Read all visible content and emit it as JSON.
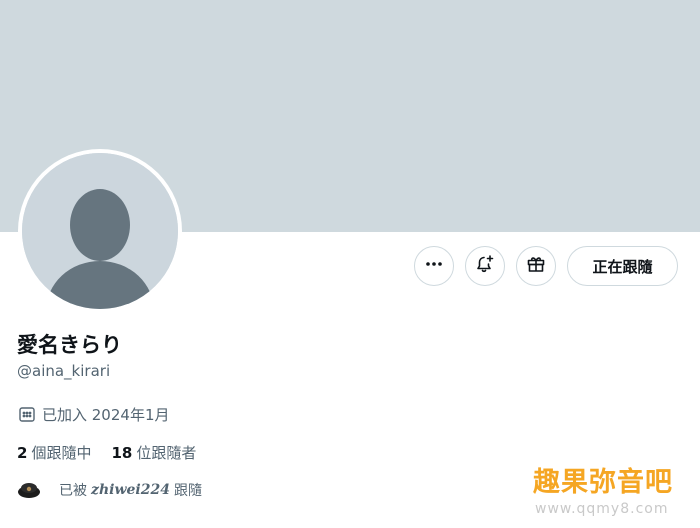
{
  "profile": {
    "display_name": "愛名きらり",
    "handle": "@aina_kirari",
    "joined": "已加入 2024年1月"
  },
  "actions": {
    "more_icon": "more-horizontal-icon",
    "notify_icon": "bell-plus-icon",
    "gift_icon": "gift-icon",
    "following_label": "正在跟隨"
  },
  "stats": {
    "following_count": "2",
    "following_label": "個跟隨中",
    "followers_count": "18",
    "followers_label": "位跟隨者"
  },
  "followed_by": {
    "prefix": "已被",
    "user": "zhiwei224",
    "suffix": "跟隨"
  },
  "watermark": {
    "title": "趣果弥音吧",
    "url": "www.qqmy8.com"
  },
  "colors": {
    "banner": "#cfd9de",
    "secondary_text": "#536471",
    "primary_text": "#0f1419",
    "watermark": "#f5a623"
  }
}
